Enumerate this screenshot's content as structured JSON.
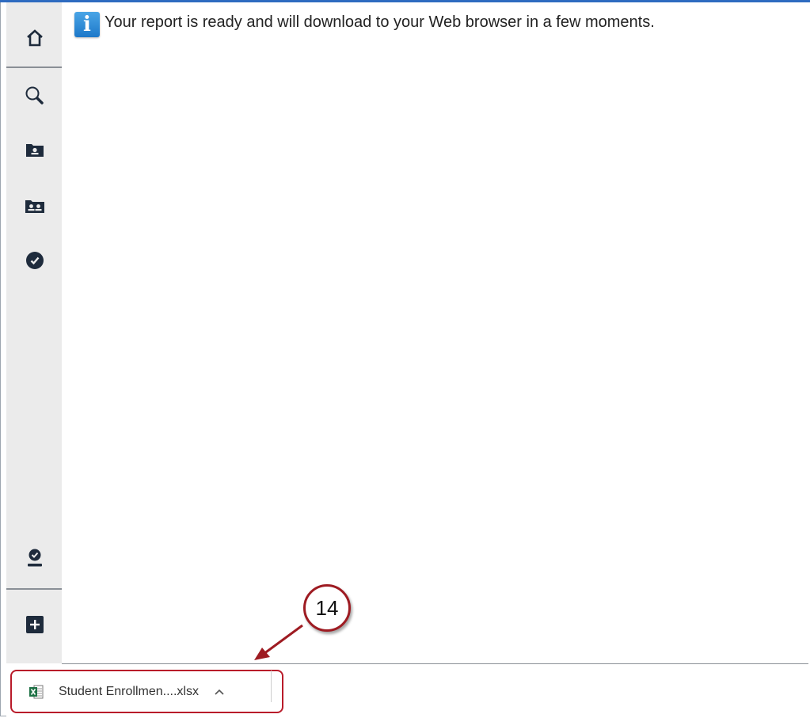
{
  "message": {
    "icon": "info-icon",
    "icon_glyph": "i",
    "text": "Your report is ready and will download to your Web browser in a few moments."
  },
  "sidebar": {
    "items": [
      {
        "name": "home",
        "icon": "home-icon"
      },
      {
        "name": "search",
        "icon": "search-icon"
      },
      {
        "name": "student-folder",
        "icon": "student-folder-icon"
      },
      {
        "name": "group-folder",
        "icon": "group-folder-icon"
      },
      {
        "name": "check",
        "icon": "check-circle-icon"
      },
      {
        "name": "user-check",
        "icon": "user-check-icon"
      },
      {
        "name": "add",
        "icon": "plus-icon"
      }
    ]
  },
  "download": {
    "filename": "Student Enrollmen....xlsx",
    "file_icon": "excel-file-icon",
    "menu_icon": "chevron-up-icon"
  },
  "annotation": {
    "step_number": "14",
    "color": "#9e1b22"
  },
  "colors": {
    "accent": "#2e6bc0",
    "sidebar_bg": "#ebebeb",
    "icon_dark": "#1e2b3c",
    "highlight": "#b91b2a"
  }
}
